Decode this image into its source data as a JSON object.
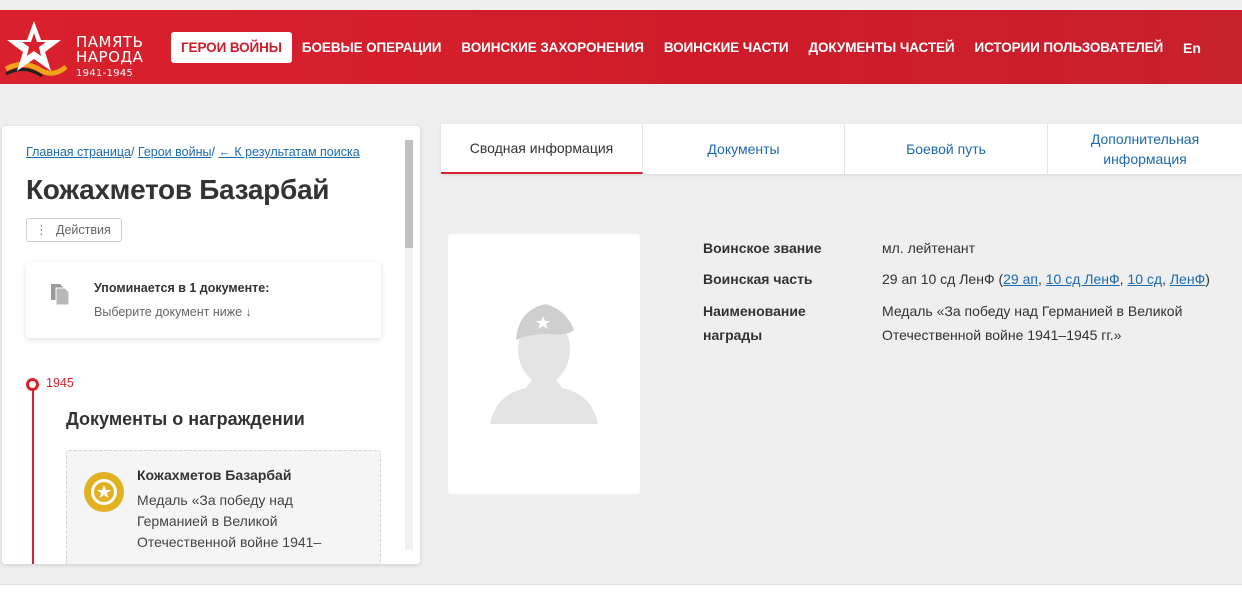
{
  "header": {
    "logo_line1": "ПАМЯТЬ",
    "logo_line2": "НАРОДА",
    "logo_years": "1941-1945",
    "nav": [
      {
        "label": "ГЕРОИ ВОЙНЫ",
        "active": true
      },
      {
        "label": "БОЕВЫЕ ОПЕРАЦИИ"
      },
      {
        "label": "ВОИНСКИЕ ЗАХОРОНЕНИЯ"
      },
      {
        "label": "ВОИНСКИЕ ЧАСТИ"
      },
      {
        "label": "ДОКУМЕНТЫ ЧАСТЕЙ"
      },
      {
        "label": "ИСТОРИИ ПОЛЬЗОВАТЕЛЕЙ"
      }
    ],
    "lang": "En",
    "brand_color": "#d9212d"
  },
  "breadcrumb": {
    "home": "Главная страница",
    "sep1": "/ ",
    "heroes": "Герои войны",
    "sep2": "/ ",
    "back": "← К результатам поиска"
  },
  "person": {
    "name": "Кожахметов Базарбай",
    "actions_label": "Действия"
  },
  "mention": {
    "title": "Упоминается в 1 документе:",
    "subtitle": "Выберите документ ниже ↓"
  },
  "timeline": {
    "year": "1945",
    "section_title": "Документы о награждении",
    "doc": {
      "name": "Кожахметов Базарбай",
      "text": "Медаль «За победу над Германией в Великой Отечественной войне 1941–"
    }
  },
  "tabs": [
    {
      "label": "Сводная информация",
      "active": true
    },
    {
      "label": "Документы"
    },
    {
      "label": "Боевой путь"
    },
    {
      "label_line1": "Дополнительная",
      "label_line2": "информация"
    }
  ],
  "info": {
    "rank_label": "Воинское звание",
    "rank_value": "мл. лейтенант",
    "unit_label": "Воинская часть",
    "unit_value_prefix": "29 ап 10 сд ЛенФ (",
    "unit_links": [
      "29 ап",
      "10 сд ЛенФ",
      "10 сд",
      "ЛенФ"
    ],
    "unit_value_suffix": ")",
    "award_label_line1": "Наименование",
    "award_label_line2": "награды",
    "award_value_line1": "Медаль «За победу над Германией в Великой",
    "award_value_line2": "Отечественной войне 1941–1945 гг.»"
  }
}
